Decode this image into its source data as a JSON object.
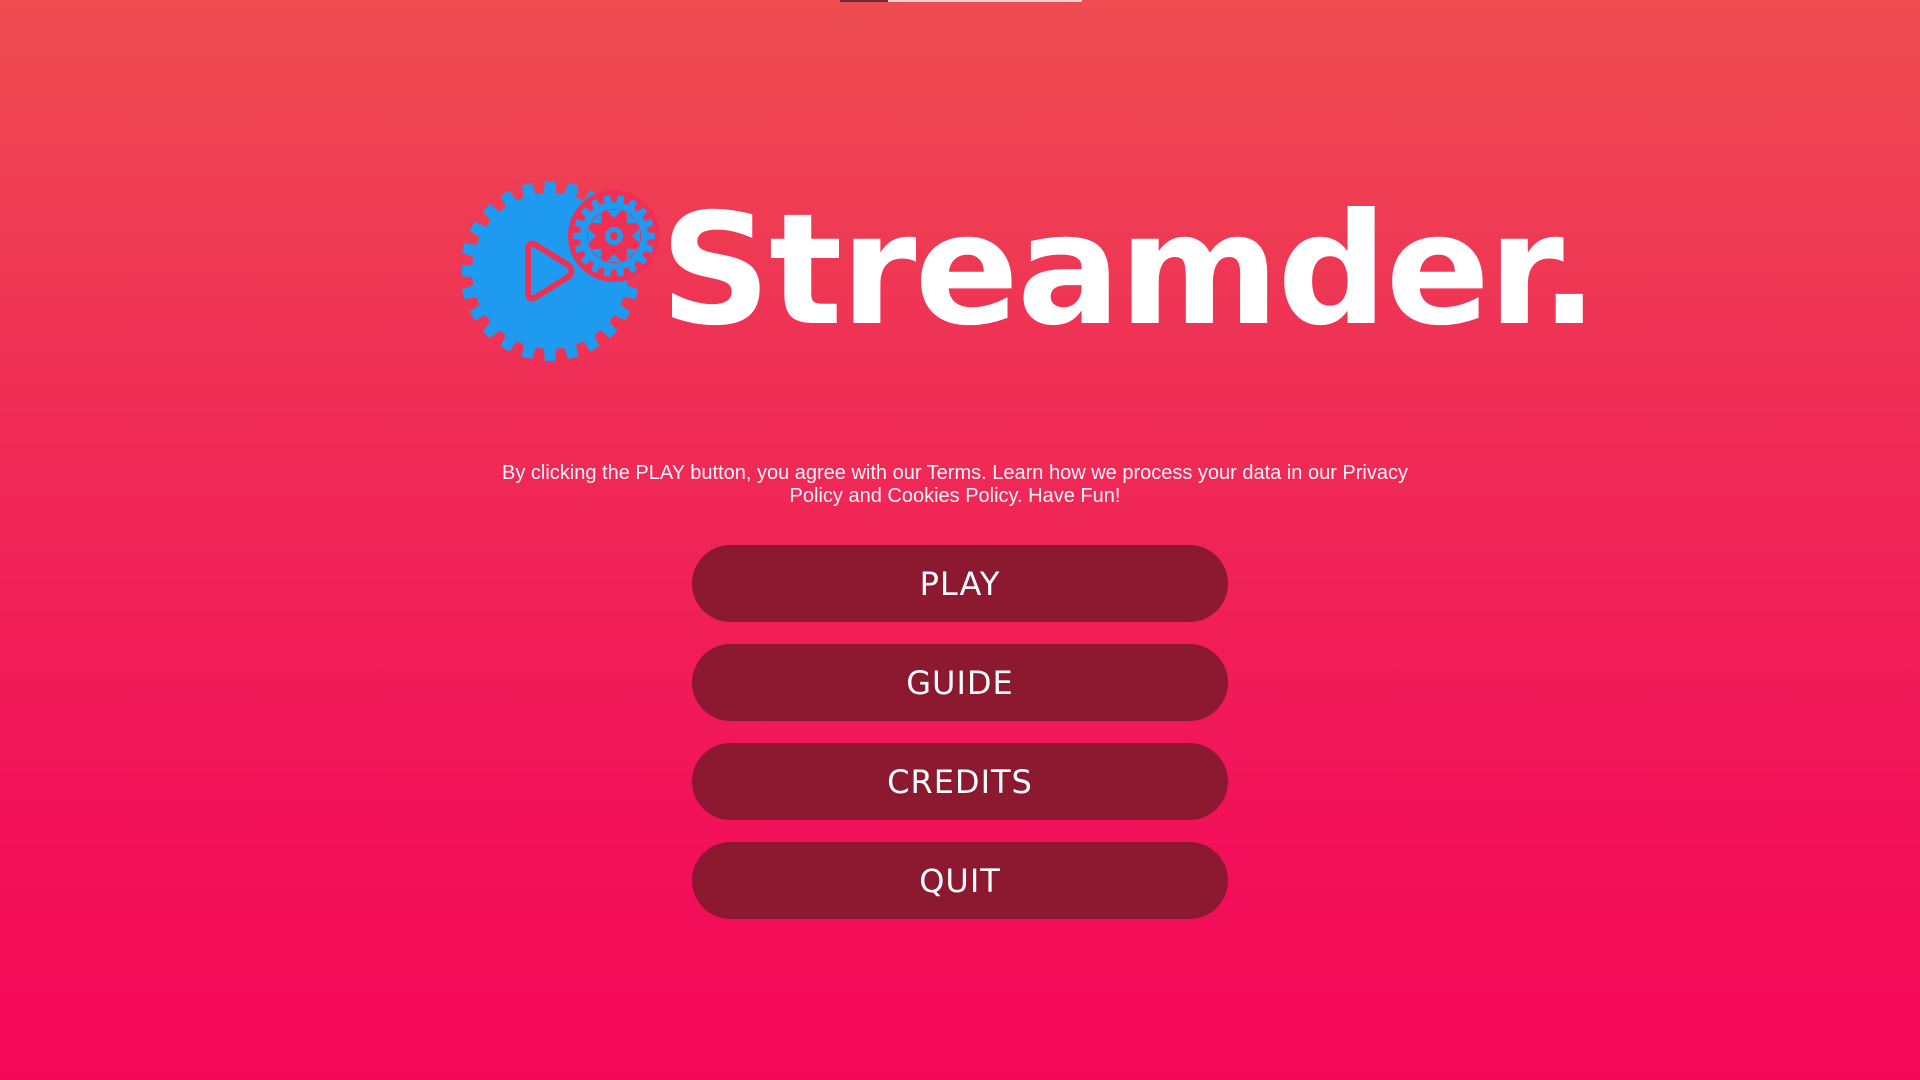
{
  "logo": {
    "wordmark": "Streamder.",
    "icon": "gear-play-icon",
    "icon_color": "#1e9bf0",
    "accent_color": "#ef2f56"
  },
  "terms": {
    "text": "By clicking the PLAY button, you agree with our Terms. Learn how we process your data in our Privacy Policy and Cookies Policy. Have Fun!"
  },
  "menu": {
    "play_label": "PLAY",
    "guide_label": "GUIDE",
    "credits_label": "CREDITS",
    "quit_label": "QUIT"
  },
  "colors": {
    "background_top": "#ef4d51",
    "background_bottom": "#f50758",
    "button": "#8c1930",
    "text": "#ffffff"
  }
}
